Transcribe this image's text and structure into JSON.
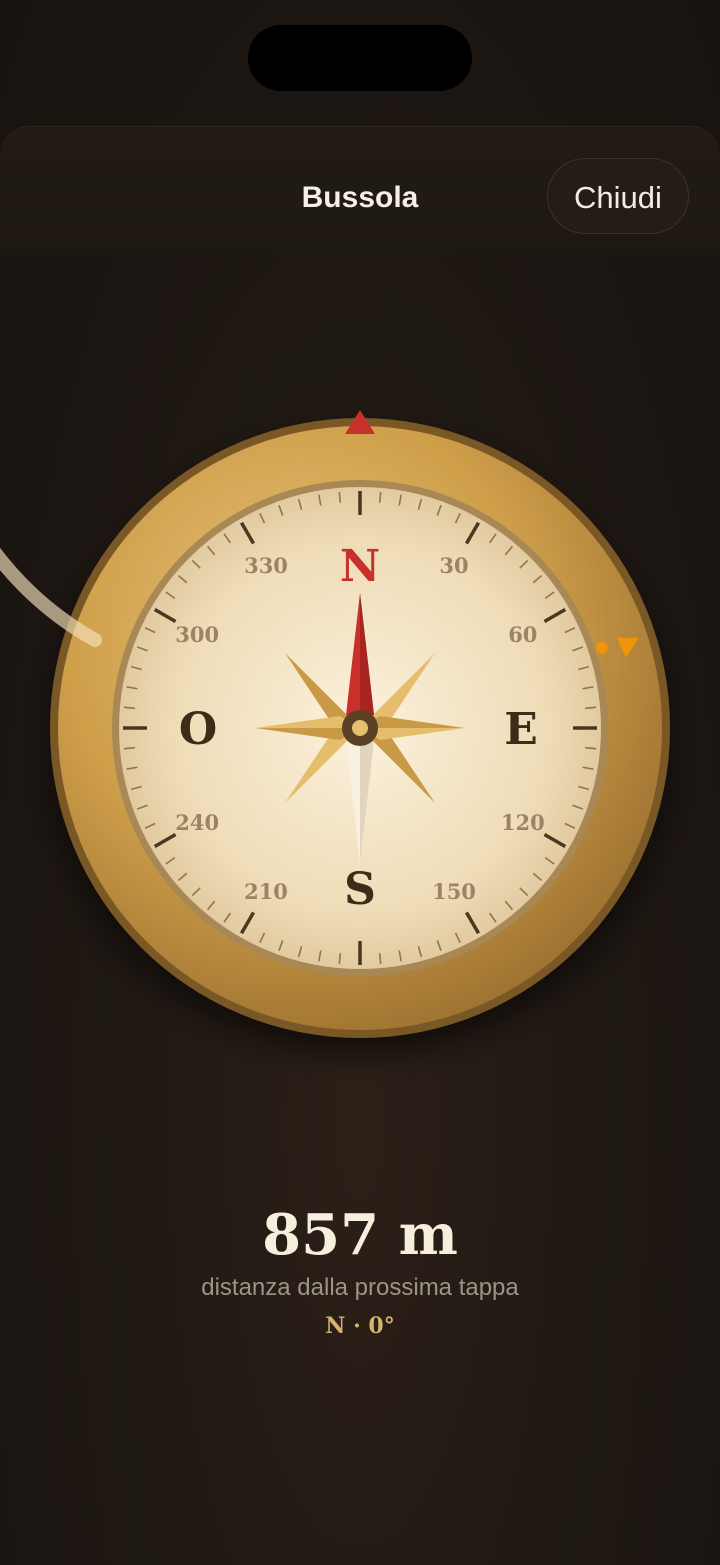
{
  "header": {
    "title": "Bussola",
    "close_label": "Chiudi"
  },
  "compass": {
    "cardinals": {
      "north": "N",
      "east": "E",
      "south": "S",
      "west": "O"
    },
    "degree_labels": [
      "30",
      "60",
      "120",
      "150",
      "210",
      "240",
      "300",
      "330"
    ],
    "heading_degrees": 0,
    "waypoint_bearing_degrees": 70,
    "colors": {
      "north_marker": "#c8302c",
      "waypoint_marker": "#f0950a",
      "bezel_gold": "#c99a45",
      "face_cream": "#f1e2c4",
      "needle_red": "#c8302c"
    }
  },
  "readout": {
    "distance": "857 m",
    "distance_label": "distanza dalla prossima tappa",
    "heading": "N · 0°"
  }
}
